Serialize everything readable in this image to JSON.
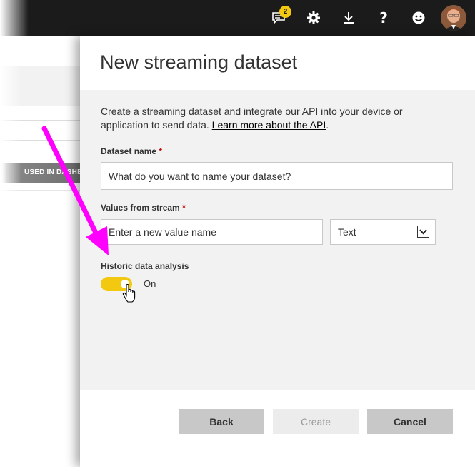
{
  "background": {
    "table_header": "USED IN DASHBO"
  },
  "topbar": {
    "notifications_badge": "2",
    "icons": [
      "notifications-icon",
      "gear-icon",
      "download-icon",
      "help-icon",
      "smiley-icon",
      "avatar"
    ]
  },
  "dialog": {
    "title": "New streaming dataset",
    "description": "Create a streaming dataset and integrate our API into your device or application to send data.",
    "learn_more": "Learn more about the API",
    "dataset_name": {
      "label": "Dataset name",
      "required_mark": "*",
      "placeholder": "What do you want to name your dataset?"
    },
    "values_from_stream": {
      "label": "Values from stream",
      "required_mark": "*",
      "placeholder": "Enter a new value name",
      "type_selected": "Text"
    },
    "historic": {
      "label": "Historic data analysis",
      "state": "On"
    },
    "buttons": {
      "back": "Back",
      "create": "Create",
      "cancel": "Cancel"
    }
  },
  "colors": {
    "accent_yellow": "#f2c811",
    "annotation_magenta": "#ff00ff",
    "topbar": "#1b1b1b"
  }
}
